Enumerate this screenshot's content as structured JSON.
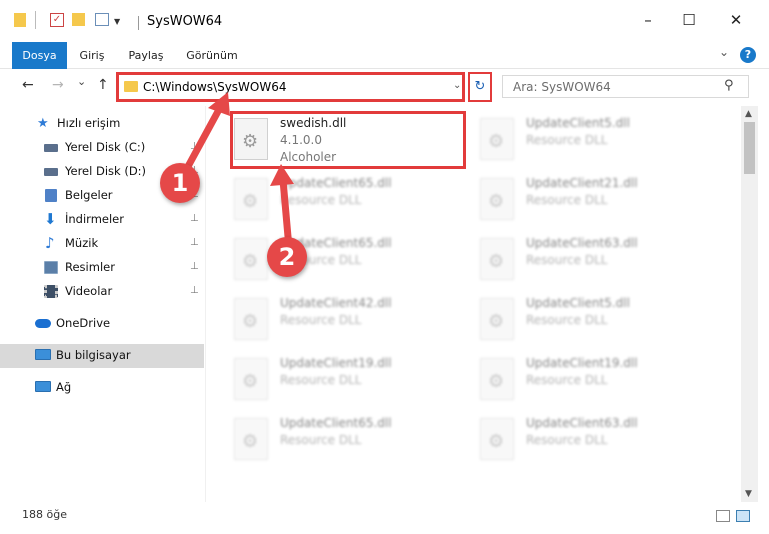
{
  "window": {
    "title": "SysWOW64",
    "minimize_glyph": "–",
    "maximize_glyph": "☐",
    "close_glyph": "✕"
  },
  "ribbon": {
    "tabs": [
      "Dosya",
      "Giriş",
      "Paylaş",
      "Görünüm"
    ],
    "expand_glyph": "⌄",
    "help_glyph": "?"
  },
  "nav": {
    "back_glyph": "←",
    "forward_glyph": "→",
    "recent_glyph": "⌄",
    "up_glyph": "↑",
    "address": "C:\\Windows\\SysWOW64",
    "address_dropdown_glyph": "⌄",
    "refresh_glyph": "↻",
    "search_placeholder": "Ara: SysWOW64",
    "search_glyph": "⚲"
  },
  "sidebar": {
    "items": [
      {
        "label": "Hızlı erişim",
        "icon": "star-icon",
        "color": "#2f7bd6",
        "pinned": false
      },
      {
        "label": "Yerel Disk (C:)",
        "icon": "drive-icon",
        "color": "#5a6f8c",
        "pinned": true
      },
      {
        "label": "Yerel Disk (D:)",
        "icon": "drive-icon",
        "color": "#5a6f8c",
        "pinned": true
      },
      {
        "label": "Belgeler",
        "icon": "documents-icon",
        "color": "#4f81c7",
        "pinned": true
      },
      {
        "label": "İndirmeler",
        "icon": "download-icon",
        "color": "#1f78d1",
        "pinned": true
      },
      {
        "label": "Müzik",
        "icon": "music-icon",
        "color": "#2f7bd6",
        "pinned": true
      },
      {
        "label": "Resimler",
        "icon": "pictures-icon",
        "color": "#5b7fa8",
        "pinned": true
      },
      {
        "label": "Videolar",
        "icon": "videos-icon",
        "color": "#3d4f66",
        "pinned": true
      },
      {
        "label": "OneDrive",
        "icon": "cloud-icon",
        "color": "#1a6fd1",
        "pinned": false
      },
      {
        "label": "Bu bilgisayar",
        "icon": "computer-icon",
        "color": "#3b8fd9",
        "pinned": false
      },
      {
        "label": "Ağ",
        "icon": "network-icon",
        "color": "#3b8fd9",
        "pinned": false
      }
    ],
    "pin_glyph": "📌"
  },
  "files": {
    "selected": {
      "name": "swedish.dll",
      "version": "4.1.0.0",
      "company": "Alcoholer"
    },
    "others": [
      {
        "name": "UpdateClient5.dll",
        "type": "Resource DLL"
      },
      {
        "name": "UpdateClient65.dll",
        "type": "Resource DLL"
      },
      {
        "name": "UpdateClient21.dll",
        "type": "Resource DLL"
      },
      {
        "name": "UpdateClient65.dll",
        "type": "Resource DLL"
      },
      {
        "name": "UpdateClient63.dll",
        "type": "Resource DLL"
      },
      {
        "name": "UpdateClient42.dll",
        "type": "Resource DLL"
      },
      {
        "name": "UpdateClient5.dll",
        "type": "Resource DLL"
      },
      {
        "name": "UpdateClient19.dll",
        "type": "Resource DLL"
      },
      {
        "name": "UpdateClient19.dll",
        "type": "Resource DLL"
      },
      {
        "name": "UpdateClient65.dll",
        "type": "Resource DLL"
      },
      {
        "name": "UpdateClient63.dll",
        "type": "Resource DLL"
      }
    ]
  },
  "status": {
    "item_count": "188 öğe"
  },
  "callouts": {
    "one": "1",
    "two": "2"
  },
  "colors": {
    "accent": "#1979ca",
    "highlight": "#e23b3b",
    "callout": "#e54848"
  }
}
